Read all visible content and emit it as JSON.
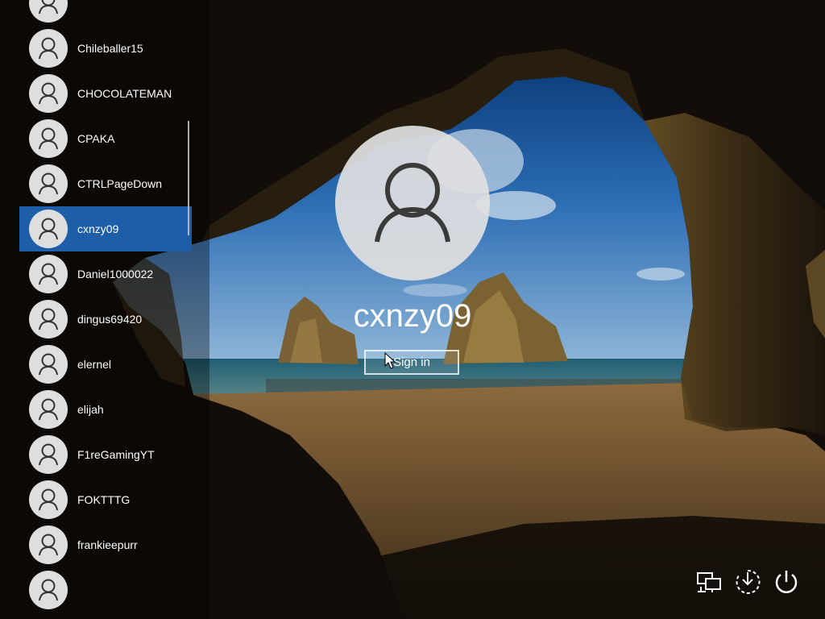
{
  "users": [
    {
      "name": ""
    },
    {
      "name": "Chileballer15"
    },
    {
      "name": "CHOCOLATEMAN"
    },
    {
      "name": "CPAKA"
    },
    {
      "name": "CTRLPageDown"
    },
    {
      "name": "cxnzy09",
      "selected": true
    },
    {
      "name": "Daniel1000022"
    },
    {
      "name": "dingus69420"
    },
    {
      "name": "elernel"
    },
    {
      "name": "elijah"
    },
    {
      "name": "F1reGamingYT"
    },
    {
      "name": "FOKTTTG"
    },
    {
      "name": "frankieepurr"
    },
    {
      "name": ""
    }
  ],
  "login": {
    "account_name": "cxnzy09",
    "signin_label": "Sign in"
  },
  "system_icons": [
    "network-icon",
    "ease-of-access-icon",
    "power-icon"
  ],
  "colors": {
    "selected_item": "#1e5ea8",
    "avatar_bg": "#dedede",
    "text": "#ffffff"
  }
}
